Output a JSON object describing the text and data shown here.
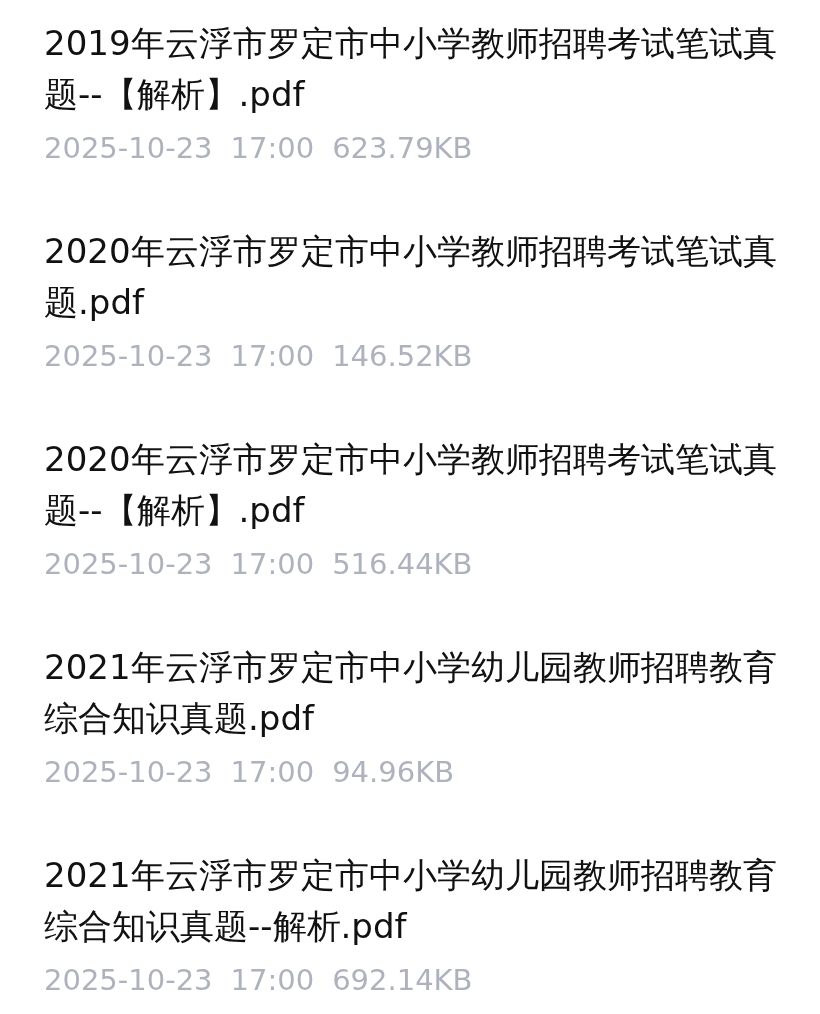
{
  "files": [
    {
      "name": "2019年云浮市罗定市中小学教师招聘考试笔试真题--【解析】.pdf",
      "date": "2025-10-23",
      "time": "17:00",
      "size": "623.79KB"
    },
    {
      "name": "2020年云浮市罗定市中小学教师招聘考试笔试真题.pdf",
      "date": "2025-10-23",
      "time": "17:00",
      "size": "146.52KB"
    },
    {
      "name": "2020年云浮市罗定市中小学教师招聘考试笔试真题--【解析】.pdf",
      "date": "2025-10-23",
      "time": "17:00",
      "size": "516.44KB"
    },
    {
      "name": "2021年云浮市罗定市中小学幼儿园教师招聘教育综合知识真题.pdf",
      "date": "2025-10-23",
      "time": "17:00",
      "size": "94.96KB"
    },
    {
      "name": "2021年云浮市罗定市中小学幼儿园教师招聘教育综合知识真题--解析.pdf",
      "date": "2025-10-23",
      "time": "17:00",
      "size": "692.14KB"
    }
  ]
}
